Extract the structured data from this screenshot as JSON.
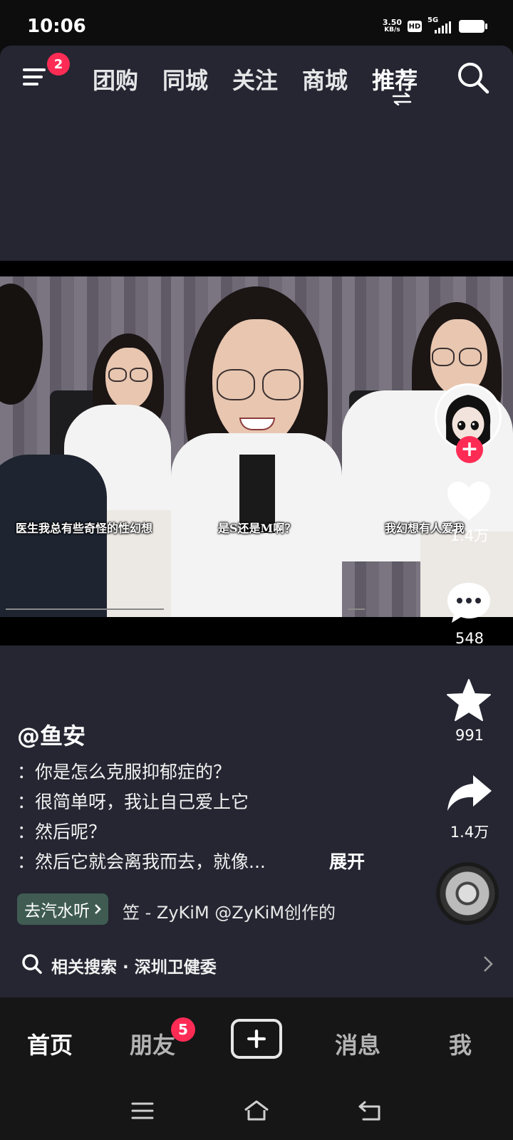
{
  "status_bar": {
    "time": "10:06",
    "net_speed_value": "3.50",
    "net_speed_unit": "KB/s",
    "hd_label": "HD",
    "network_type": "5G"
  },
  "top_nav": {
    "menu_badge": "2",
    "tabs": [
      "团购",
      "同城",
      "关注",
      "商城",
      "推荐"
    ],
    "active_tab": "推荐"
  },
  "video": {
    "subtitles": [
      "医生我总有些奇怪的性幻想",
      "是S还是M啊？",
      "我幻想有人爱我"
    ]
  },
  "actions": {
    "like_count": "1.4万",
    "comment_count": "548",
    "favorite_count": "991",
    "share_count": "1.4万"
  },
  "post": {
    "author": "@鱼安",
    "lines": [
      "：你是怎么克服抑郁症的？",
      "：很简单呀，我让自己爱上它",
      "：然后呢？",
      "：然后它就会离我而去，就像..."
    ],
    "expand_label": "展开",
    "music_chip_label": "去汽水听",
    "music_text": "笠 - ZyKiM    @ZyKiM创作的"
  },
  "related_search": {
    "prefix": "相关搜索",
    "separator": "·",
    "query": "深圳卫健委"
  },
  "bottom_nav": {
    "items": [
      "首页",
      "朋友",
      "消息",
      "我"
    ],
    "friends_badge": "5"
  },
  "colors": {
    "accent": "#fe2c55",
    "panel_bg": "#252632",
    "music_chip_bg": "#3f5b52"
  }
}
